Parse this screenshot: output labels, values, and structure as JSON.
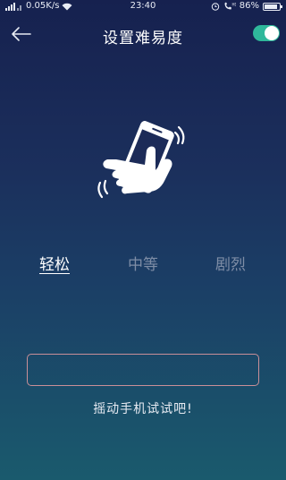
{
  "status_bar": {
    "network_speed": "0.05K/s",
    "time": "23:40",
    "battery": "86%",
    "battery_level": 0.86,
    "icons": [
      "signal-icon",
      "wifi-icon",
      "alarm-icon",
      "phone-hd-icon",
      "battery-icon"
    ]
  },
  "header": {
    "title": "设置难易度",
    "back_icon": "arrow-left-icon",
    "toggle_on": true
  },
  "illustration": {
    "icon": "shake-phone-icon"
  },
  "difficulty": {
    "options": [
      {
        "label": "轻松",
        "selected": true
      },
      {
        "label": "中等",
        "selected": false
      },
      {
        "label": "剧烈",
        "selected": false
      }
    ]
  },
  "result": {
    "value": ""
  },
  "prompt": "摇动手机试试吧!",
  "colors": {
    "toggle_on": "#2fb89b",
    "box_border": "#c98f98",
    "unselected_text": "#7e8da6"
  }
}
